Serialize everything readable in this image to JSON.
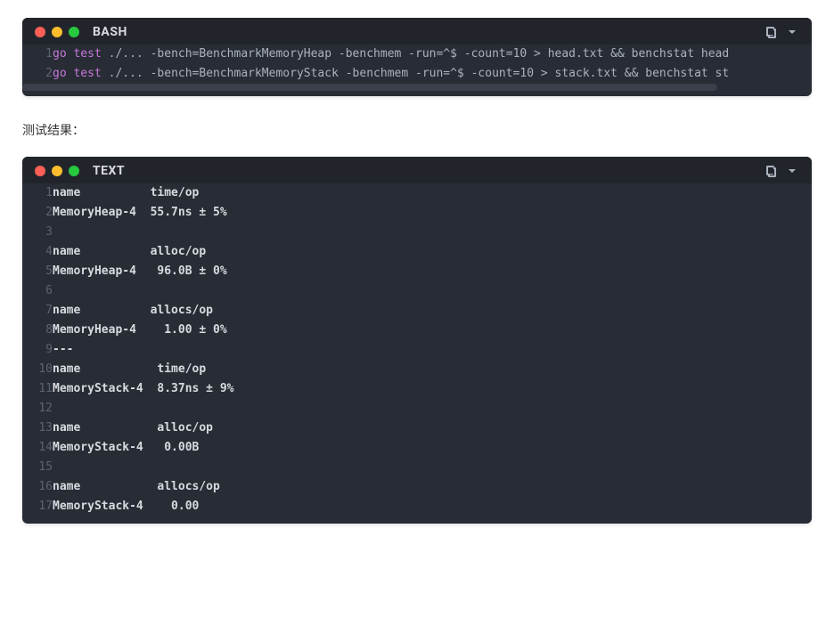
{
  "block1": {
    "label": "BASH",
    "lines": [
      {
        "n": "1",
        "segments": [
          {
            "cls": "tok-kw",
            "t": "go "
          },
          {
            "cls": "tok-kw",
            "t": "test"
          },
          {
            "cls": "",
            "t": " ./... -bench=BenchmarkMemoryHeap -benchmem -run=^$ -count=10 > head.txt && benchstat head"
          }
        ]
      },
      {
        "n": "2",
        "segments": [
          {
            "cls": "tok-kw",
            "t": "go "
          },
          {
            "cls": "tok-kw",
            "t": "test"
          },
          {
            "cls": "",
            "t": " ./... -bench=BenchmarkMemoryStack -benchmem -run=^$ -count=10 > stack.txt && benchstat st"
          }
        ]
      }
    ]
  },
  "intertext": "测试结果：",
  "block2": {
    "label": "TEXT",
    "lines": [
      {
        "n": "1",
        "t": "name          time/op"
      },
      {
        "n": "2",
        "t": "MemoryHeap-4  55.7ns ± 5%"
      },
      {
        "n": "3",
        "t": ""
      },
      {
        "n": "4",
        "t": "name          alloc/op"
      },
      {
        "n": "5",
        "t": "MemoryHeap-4   96.0B ± 0%"
      },
      {
        "n": "6",
        "t": ""
      },
      {
        "n": "7",
        "t": "name          allocs/op"
      },
      {
        "n": "8",
        "t": "MemoryHeap-4    1.00 ± 0%"
      },
      {
        "n": "9",
        "t": "---"
      },
      {
        "n": "10",
        "t": "name           time/op"
      },
      {
        "n": "11",
        "t": "MemoryStack-4  8.37ns ± 9%"
      },
      {
        "n": "12",
        "t": ""
      },
      {
        "n": "13",
        "t": "name           alloc/op"
      },
      {
        "n": "14",
        "t": "MemoryStack-4   0.00B"
      },
      {
        "n": "15",
        "t": ""
      },
      {
        "n": "16",
        "t": "name           allocs/op"
      },
      {
        "n": "17",
        "t": "MemoryStack-4    0.00"
      }
    ]
  }
}
